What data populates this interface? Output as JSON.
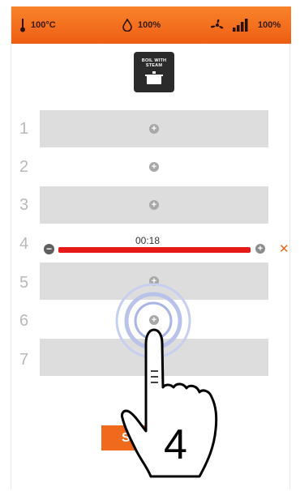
{
  "header": {
    "temperature": "100°C",
    "humidity": "100%",
    "fan": "100%",
    "colors": {
      "bar": "#f17020",
      "text": "#3a1a08"
    }
  },
  "program": {
    "label": "BOIL WITH STEAM",
    "icon": "pot-icon"
  },
  "slots": [
    {
      "number": "1"
    },
    {
      "number": "2"
    },
    {
      "number": "3"
    },
    {
      "number": "4",
      "timer": "00:18",
      "active": true
    },
    {
      "number": "5"
    },
    {
      "number": "6"
    },
    {
      "number": "7"
    }
  ],
  "stop_button": {
    "label": "STO"
  },
  "annotation": {
    "step_number": "4",
    "gesture": "tap-icon"
  }
}
